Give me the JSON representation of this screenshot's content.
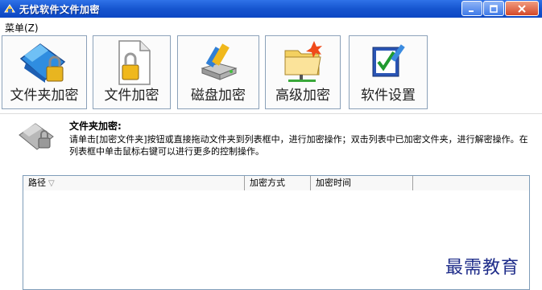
{
  "window": {
    "title": "无忧软件文件加密",
    "controls": [
      "minimize",
      "maximize",
      "close"
    ]
  },
  "menu": {
    "items": [
      {
        "label": "菜单(Z)"
      }
    ]
  },
  "toolbar": {
    "buttons": [
      {
        "label": "文件夹加密",
        "icon": "folder-lock-icon"
      },
      {
        "label": "文件加密",
        "icon": "file-lock-icon"
      },
      {
        "label": "磁盘加密",
        "icon": "disk-lock-icon"
      },
      {
        "label": "高级加密",
        "icon": "advanced-folder-icon"
      },
      {
        "label": "软件设置",
        "icon": "settings-check-icon"
      }
    ]
  },
  "description": {
    "title": "文件夹加密:",
    "text": "请单击[加密文件夹]按钮或直接拖动文件夹到列表框中，进行加密操作；双击列表中已加密文件夹，进行解密操作。在列表框中单击鼠标右键可以进行更多的控制操作。"
  },
  "list": {
    "columns": [
      {
        "label": "路径",
        "sorted": true
      },
      {
        "label": "加密方式"
      },
      {
        "label": "加密时间"
      },
      {
        "label": ""
      }
    ],
    "rows": []
  },
  "watermark": "最需教育",
  "colors": {
    "titlebar": "#1655cf",
    "close": "#d4492a",
    "watermark": "#1f2d8a"
  }
}
